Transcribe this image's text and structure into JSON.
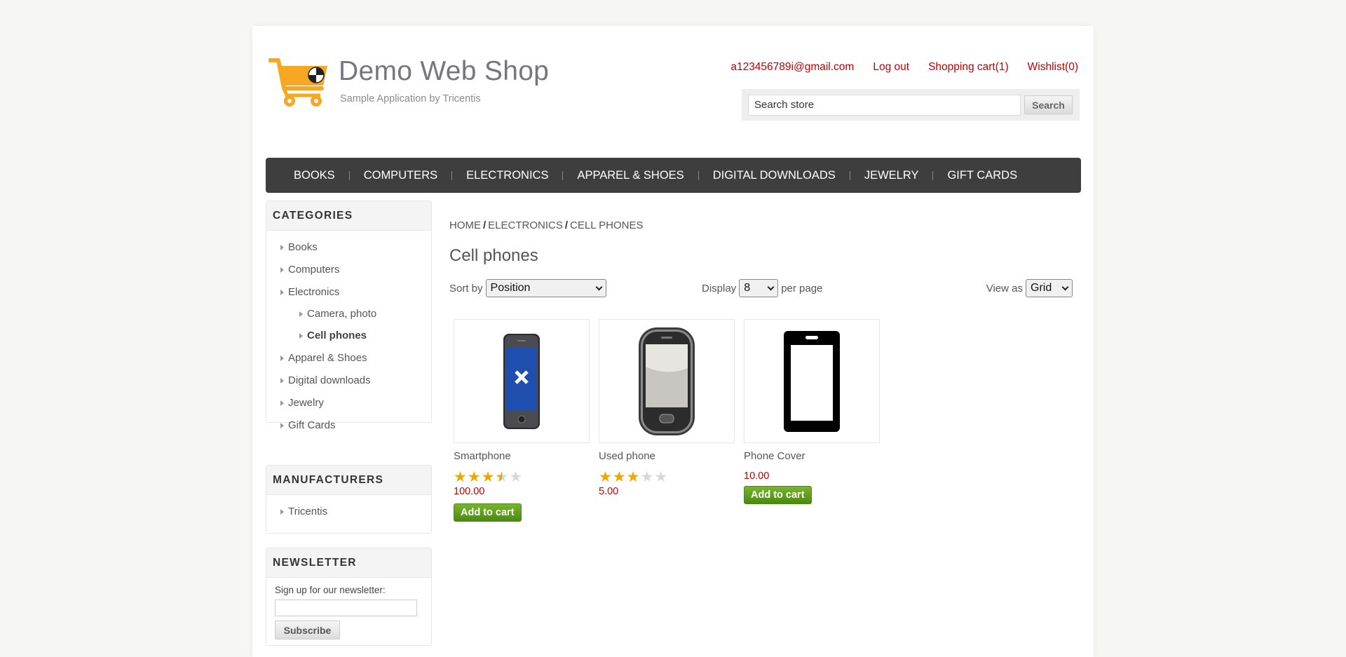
{
  "header": {
    "title": "Demo Web Shop",
    "subtitle": "Sample Application by Tricentis",
    "account_email": "a123456789i@gmail.com",
    "logout_label": "Log out",
    "cart_label": "Shopping cart(1)",
    "wishlist_label": "Wishlist(0)",
    "search_placeholder": "Search store",
    "search_button": "Search",
    "brand_color": "#f7a823",
    "link_color": "#c00000"
  },
  "top_menu": [
    "BOOKS",
    "COMPUTERS",
    "ELECTRONICS",
    "APPAREL & SHOES",
    "DIGITAL DOWNLOADS",
    "JEWELRY",
    "GIFT CARDS"
  ],
  "categories": {
    "title": "CATEGORIES",
    "items": [
      {
        "label": "Books"
      },
      {
        "label": "Computers"
      },
      {
        "label": "Electronics"
      },
      {
        "label": "Camera, photo"
      },
      {
        "label": "Cell phones"
      },
      {
        "label": "Apparel & Shoes"
      },
      {
        "label": "Digital downloads"
      },
      {
        "label": "Jewelry"
      },
      {
        "label": "Gift Cards"
      }
    ]
  },
  "manufacturers": {
    "title": "MANUFACTURERS",
    "items": [
      {
        "label": "Tricentis"
      }
    ]
  },
  "newsletter": {
    "title": "NEWSLETTER",
    "label": "Sign up for our newsletter:",
    "button": "Subscribe"
  },
  "breadcrumb": [
    "HOME",
    "ELECTRONICS",
    "CELL PHONES"
  ],
  "page_title": "Cell phones",
  "controls": {
    "sort_label": "Sort by",
    "sort_value": "Position",
    "display_label": "Display",
    "display_value": "8",
    "per_page": "per page",
    "view_label": "View as",
    "view_value": "Grid"
  },
  "products": [
    {
      "name": "Smartphone",
      "rating": 3.5,
      "price": "100.00",
      "button": "Add to cart"
    },
    {
      "name": "Used phone",
      "rating": 3,
      "price": "5.00",
      "button": ""
    },
    {
      "name": "Phone Cover",
      "rating": null,
      "price": "10.00",
      "button": "Add to cart"
    }
  ]
}
